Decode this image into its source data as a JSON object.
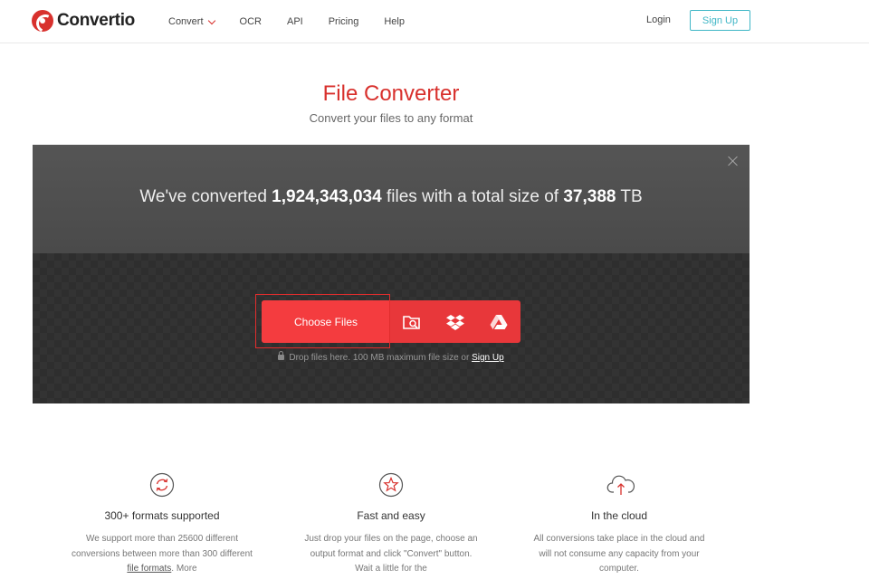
{
  "header": {
    "logo_text": "Convertio",
    "nav": [
      {
        "label": "Convert"
      },
      {
        "label": "OCR"
      },
      {
        "label": "API"
      },
      {
        "label": "Pricing"
      },
      {
        "label": "Help"
      }
    ],
    "login_label": "Login",
    "signup_label": "Sign Up"
  },
  "main": {
    "title": "File Converter",
    "subtitle": "Convert your files to any format"
  },
  "panel": {
    "stats_prefix": "We've converted ",
    "files_count": "1,924,343,034",
    "stats_middle": " files with a total size of ",
    "total_size": "37,388",
    "size_unit": " TB",
    "choose_files_label": "Choose Files",
    "source_icons": [
      "folder-search-icon",
      "dropbox-icon",
      "google-drive-icon"
    ],
    "drop_text": "Drop files here. 100 MB maximum file size or ",
    "drop_link": "Sign Up"
  },
  "features": [
    {
      "icon": "refresh-circle-icon",
      "title": "300+ formats supported",
      "text_before_link": "We support more than 25600 different conversions between more than 300 different ",
      "link": "file formats",
      "text_after_link": ". More"
    },
    {
      "icon": "star-circle-icon",
      "title": "Fast and easy",
      "text": "Just drop your files on the page, choose an output format and click \"Convert\" button. Wait a little for the"
    },
    {
      "icon": "cloud-upload-icon",
      "title": "In the cloud",
      "text": "All conversions take place in the cloud and will not consume any capacity from your computer."
    }
  ],
  "colors": {
    "brand_red": "#d8312d",
    "button_red": "#f43c3f",
    "signup_teal": "#3fb6c6",
    "panel_dark": "#333333"
  }
}
